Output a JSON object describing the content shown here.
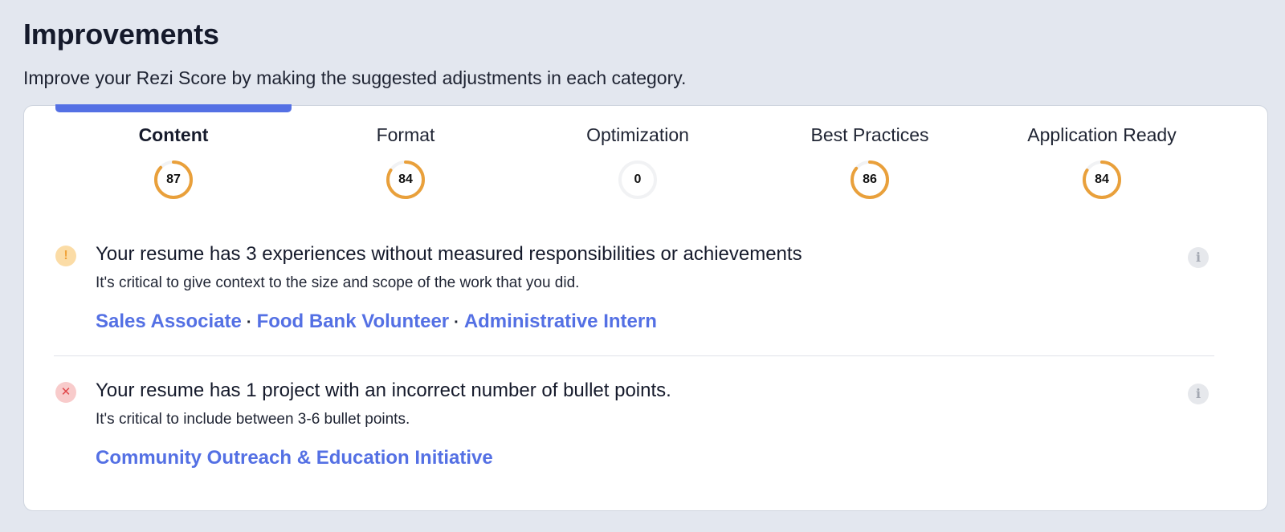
{
  "header": {
    "title": "Improvements",
    "subtitle": "Improve your Rezi Score by making the suggested adjustments in each category."
  },
  "colors": {
    "accent": "#5470e4",
    "score_ring": "#e9a03b",
    "score_track": "#f1f2f4",
    "warning": "#f0a33a",
    "error": "#e0474a"
  },
  "tabs": [
    {
      "label": "Content",
      "score": "87",
      "active": true
    },
    {
      "label": "Format",
      "score": "84",
      "active": false
    },
    {
      "label": "Optimization",
      "score": "0",
      "active": false
    },
    {
      "label": "Best Practices",
      "score": "86",
      "active": false
    },
    {
      "label": "Application Ready",
      "score": "84",
      "active": false
    }
  ],
  "items": [
    {
      "status": "warning",
      "status_icon": "!",
      "title": "Your resume has 3 experiences without measured responsibilities or achievements",
      "description": "It's critical to give context to the size and scope of the work that you did.",
      "links": [
        "Sales Associate",
        "Food Bank Volunteer",
        "Administrative Intern"
      ],
      "separator": "·",
      "info_icon": "i"
    },
    {
      "status": "error",
      "status_icon": "✕",
      "title": "Your resume has 1 project with an incorrect number of bullet points.",
      "description": "It's critical to include between 3-6 bullet points.",
      "links": [
        "Community Outreach & Education Initiative"
      ],
      "info_icon": "i"
    }
  ]
}
